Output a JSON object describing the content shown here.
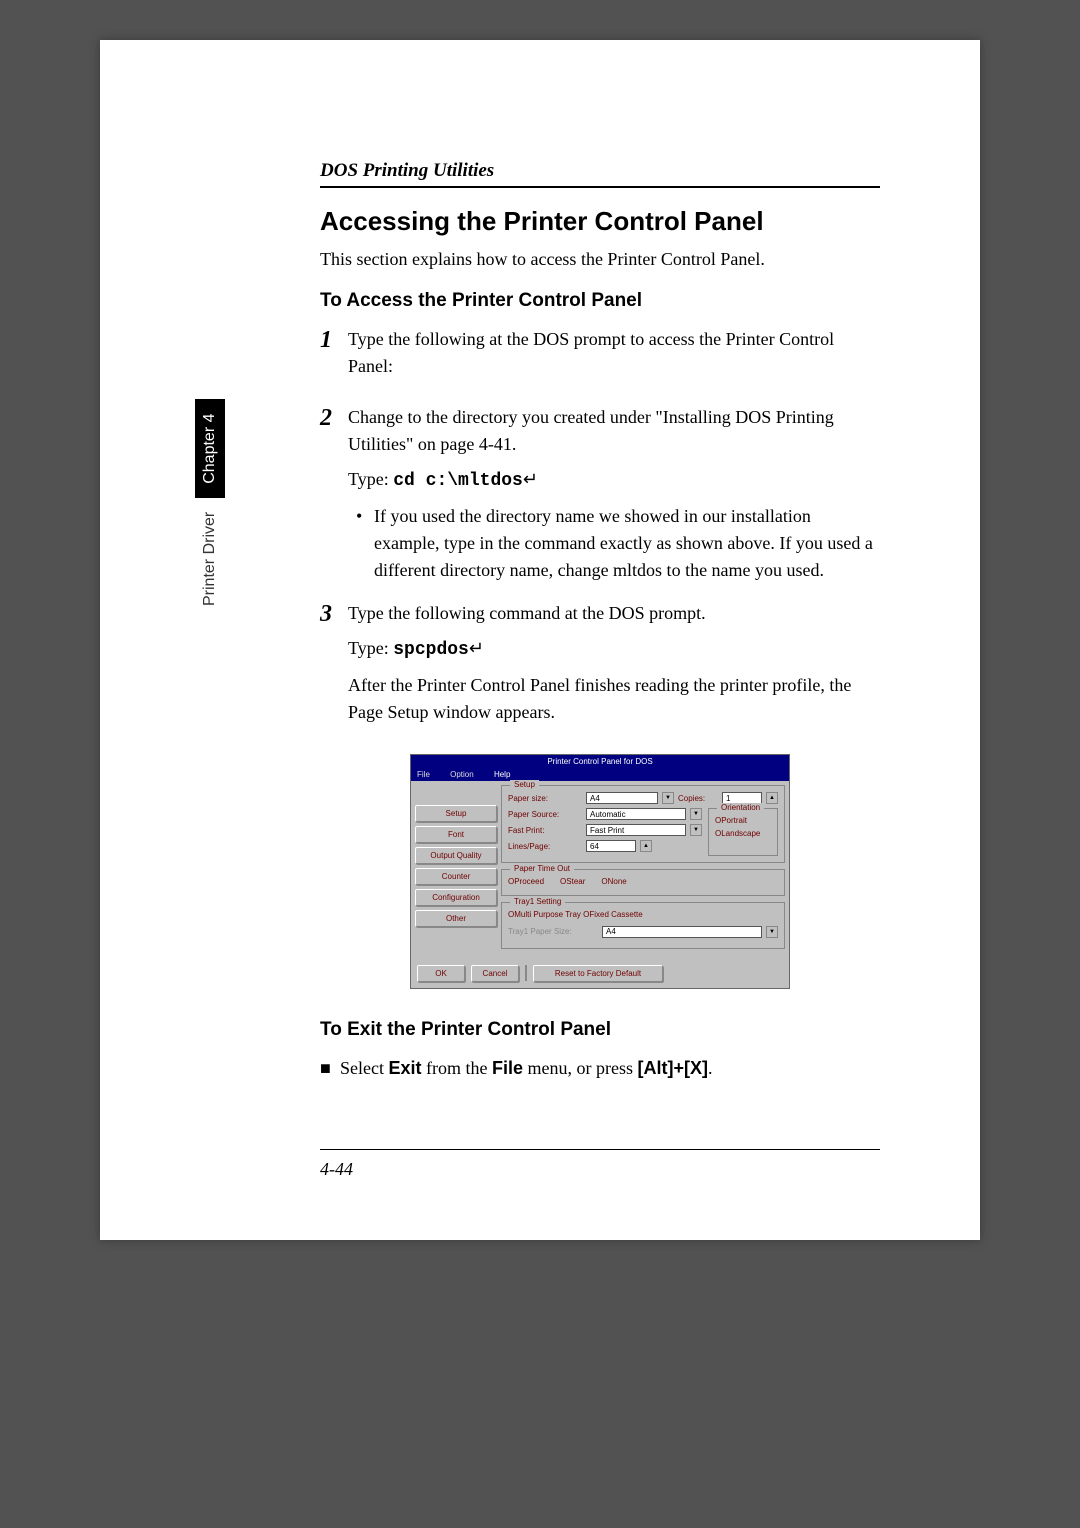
{
  "sideTab": {
    "left": "Printer Driver",
    "right": "Chapter 4"
  },
  "header": "DOS Printing Utilities",
  "title": "Accessing the Printer Control Panel",
  "intro": "This section explains how to access the Printer Control Panel.",
  "section1": {
    "heading": "To Access the Printer Control Panel",
    "steps": [
      {
        "num": "1",
        "text": "Type the following at the DOS prompt to access the Printer Control Panel:"
      },
      {
        "num": "2",
        "text": "Change to the directory you created under \"Installing DOS Printing Utilities\" on page 4-41.",
        "typeLabel": "Type: ",
        "cmd": "cd c:\\mltdos",
        "bulletText": "If you used the directory name we showed in our installation example, type in the command exactly as shown above. If you used a different directory name, change mltdos to the name you used."
      },
      {
        "num": "3",
        "text": "Type the following command at the DOS prompt.",
        "typeLabel": "Type: ",
        "cmd": "spcpdos",
        "afterText": "After the Printer Control Panel finishes reading the printer profile, the Page Setup window appears."
      }
    ]
  },
  "dosPanel": {
    "title": "Printer Control Panel for DOS",
    "menus": [
      "File",
      "Option",
      "Help"
    ],
    "sidebarButtons": [
      "Setup",
      "Font",
      "Output Quality",
      "Counter",
      "Configuration",
      "Other"
    ],
    "setupGroup": {
      "label": "Setup",
      "paperSizeLabel": "Paper size:",
      "paperSizeValue": "A4",
      "copiesLabel": "Copies:",
      "copiesValue": "1",
      "paperSourceLabel": "Paper Source:",
      "paperSourceValue": "Automatic",
      "fastPrintLabel": "Fast Print:",
      "fastPrintValue": "Fast Print",
      "linesPageLabel": "Lines/Page:",
      "linesPageValue": "64",
      "orientationLabel": "Orientation",
      "orientPortrait": "OPortrait",
      "orientLandscape": "OLandscape"
    },
    "timeoutGroup": {
      "label": "Paper Time Out",
      "opt1": "OProceed",
      "opt2": "OStear",
      "opt3": "ONone"
    },
    "trayGroup": {
      "label": "Tray1 Setting",
      "multiPurpose": "OMulti Purpose Tray OFixed Cassette",
      "trayPaperLabel": "Tray1 Paper Size:",
      "trayPaperValue": "A4"
    },
    "footerButtons": {
      "ok": "OK",
      "cancel": "Cancel",
      "reset": "Reset to Factory Default"
    }
  },
  "section2": {
    "heading": "To Exit the Printer Control Panel",
    "textBefore": "Select ",
    "exit": "Exit",
    "textMid": " from the ",
    "file": "File",
    "textMid2": " menu, or press ",
    "keys": "[Alt]+[X]",
    "textAfter": "."
  },
  "pageNum": "4-44"
}
